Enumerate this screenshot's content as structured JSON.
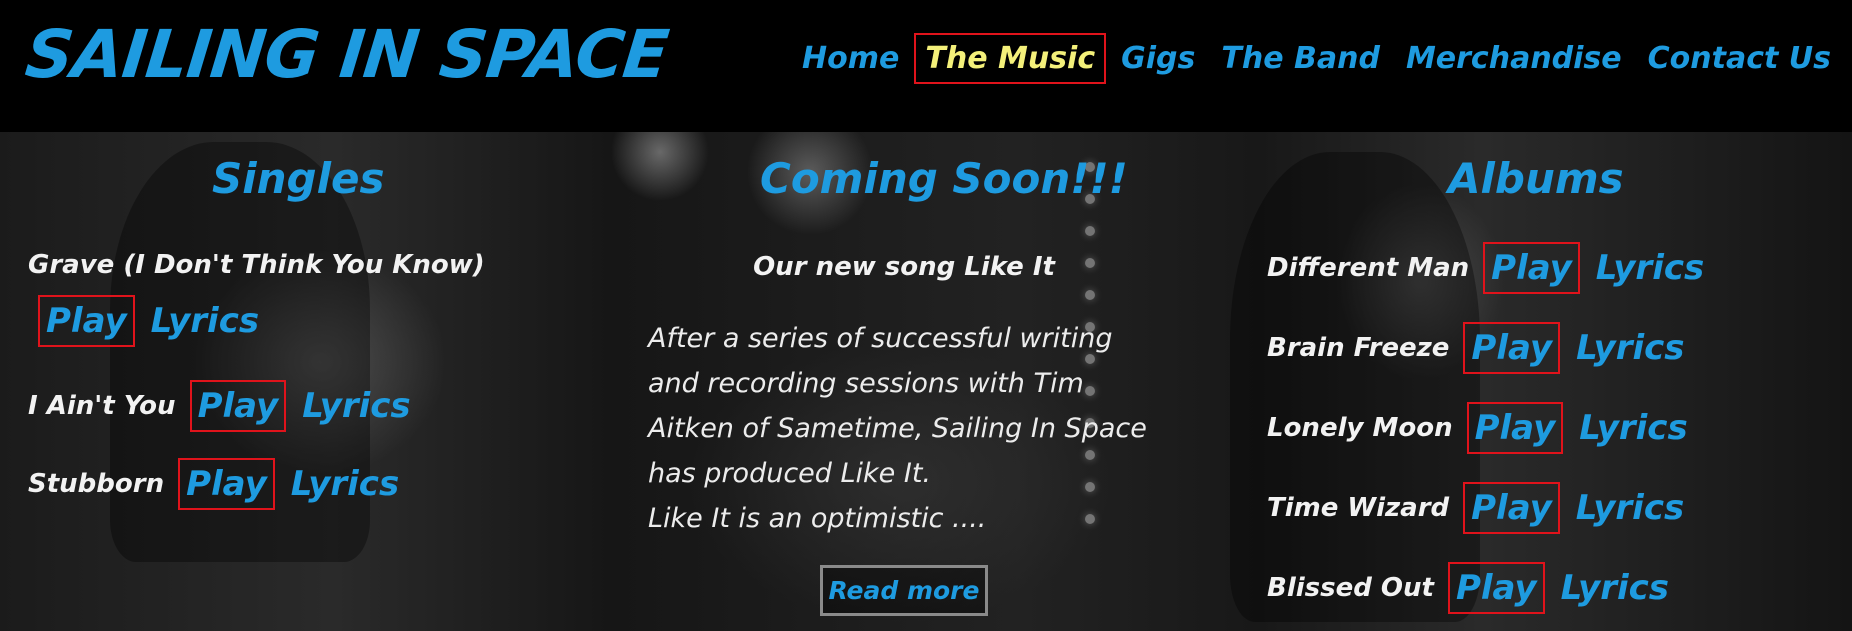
{
  "brand": {
    "logo_text": "SAILING IN SPACE",
    "color": "#1e9be0"
  },
  "nav": {
    "items": [
      {
        "label": "Home"
      },
      {
        "label": "The Music",
        "active": true
      },
      {
        "label": "Gigs"
      },
      {
        "label": "The Band"
      },
      {
        "label": "Merchandise"
      },
      {
        "label": "Contact Us"
      }
    ],
    "active_color": "#f4f07a",
    "highlight_border": "#e0131b"
  },
  "singles": {
    "title": "Singles",
    "items": [
      {
        "title": "Grave (I Don't Think You Know)",
        "play": "Play",
        "lyrics": "Lyrics"
      },
      {
        "title": "I Ain't You",
        "play": "Play",
        "lyrics": "Lyrics"
      },
      {
        "title": "Stubborn",
        "play": "Play",
        "lyrics": "Lyrics"
      }
    ]
  },
  "coming_soon": {
    "title": "Coming Soon!!!",
    "subheading": "Our new song Like It",
    "paragraph_lines": [
      "After a series of successful writing",
      "and recording sessions with Tim",
      "Aitken of Sametime, Sailing In Space",
      "has produced Like It.",
      "Like It is an optimistic ...."
    ],
    "read_more": "Read more"
  },
  "albums": {
    "title": "Albums",
    "items": [
      {
        "title": "Different Man",
        "play": "Play",
        "lyrics": "Lyrics"
      },
      {
        "title": "Brain Freeze",
        "play": "Play",
        "lyrics": "Lyrics"
      },
      {
        "title": "Lonely Moon",
        "play": "Play",
        "lyrics": "Lyrics"
      },
      {
        "title": "Time Wizard",
        "play": "Play",
        "lyrics": "Lyrics"
      },
      {
        "title": "Blissed Out",
        "play": "Play",
        "lyrics": "Lyrics"
      }
    ]
  }
}
